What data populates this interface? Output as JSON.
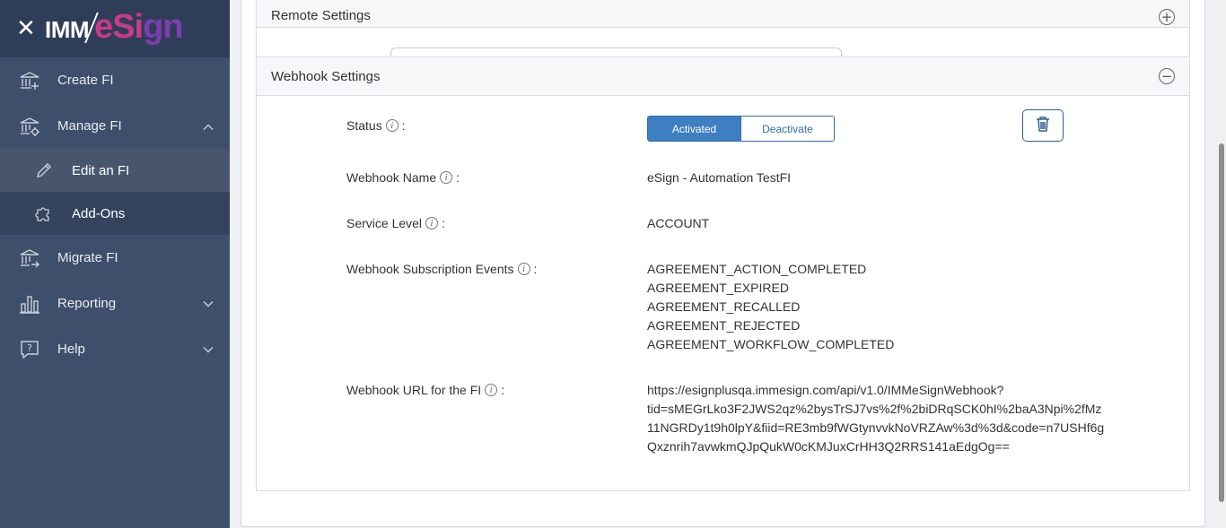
{
  "sidebar": {
    "logo_left": "IMM",
    "logo_right_e": "eSi",
    "logo_right_gn": "gn",
    "items": {
      "create": "Create FI",
      "manage": "Manage FI",
      "edit": "Edit an FI",
      "addons": "Add-Ons",
      "migrate": "Migrate FI",
      "reporting": "Reporting",
      "help": "Help"
    }
  },
  "remote": {
    "title": "Remote Settings"
  },
  "webhook": {
    "title": "Webhook Settings",
    "status_label": "Status",
    "status_on": "Activated",
    "status_off": "Deactivate",
    "name_label": "Webhook Name",
    "name_value": "eSign - Automation TestFI",
    "service_label": "Service Level",
    "service_value": "ACCOUNT",
    "events_label": "Webhook Subscription Events",
    "events": [
      "AGREEMENT_ACTION_COMPLETED",
      "AGREEMENT_EXPIRED",
      "AGREEMENT_RECALLED",
      "AGREEMENT_REJECTED",
      "AGREEMENT_WORKFLOW_COMPLETED"
    ],
    "url_label": "Webhook URL for the FI",
    "url_lines": [
      "https://esignplusqa.immesign.com/api/v1.0/IMMeSignWebhook?",
      "tid=sMEGrLko3F2JWS2qz%2bysTrSJ7vs%2f%2biDRqSCK0hI%2baA3Npi%2fMz",
      "11NGRDy1t9h0lpY&fiid=RE3mb9fWGtynvvkNoVRZAw%3d%3d&code=n7USHf6g",
      "Qxznrih7avwkmQJpQukW0cKMJuxCrHH3Q2RRS141aEdgOg=="
    ]
  },
  "colors": {
    "sidebar": "#3e4f6b",
    "accent": "#3d7fc0"
  },
  "icons": [
    "close-icon",
    "bank-plus-icon",
    "bank-gear-icon",
    "pencil-icon",
    "puzzle-icon",
    "bank-arrow-icon",
    "bar-chart-icon",
    "help-bubble-icon",
    "chevron-up-icon",
    "chevron-down-icon",
    "plus-circle-icon",
    "minus-circle-icon",
    "info-icon",
    "trash-icon"
  ]
}
